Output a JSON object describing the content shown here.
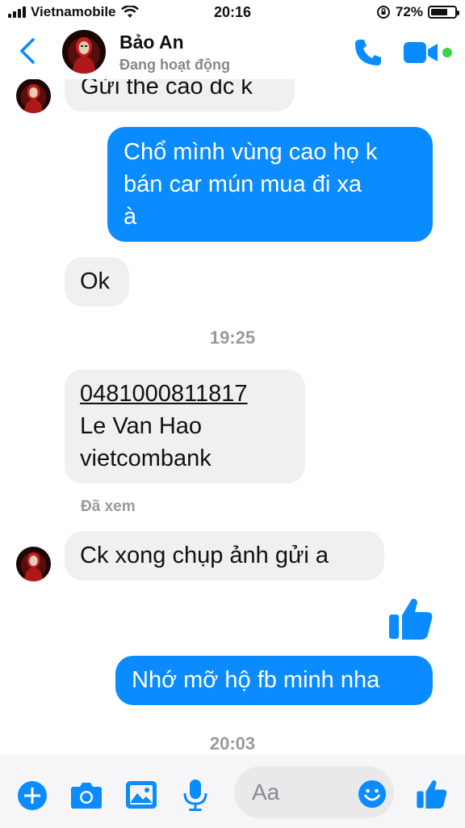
{
  "status_bar": {
    "carrier": "Vietnamobile",
    "time": "20:16",
    "battery": "72%",
    "battery_level": 0.72
  },
  "header": {
    "name": "Bảo An",
    "status": "Đang hoạt động",
    "icons": [
      "back-chevron",
      "avatar",
      "phone-icon",
      "video-icon",
      "online-dot"
    ]
  },
  "messages": {
    "m1": "Gửi the cao dc k",
    "m2_line1": "Chổ mình vùng cao họ k",
    "m2_line2": "bán car mún mua đi xa",
    "m2_line3": "à",
    "m3": "Ok",
    "time1": "19:25",
    "m4_account": "0481000811817",
    "m4_name": "Le Van Hao",
    "m4_bank": "vietcombank",
    "seen": "Đã xem",
    "m5": "Ck xong chụp ảnh gửi a",
    "m6": "Nhớ mỡ hộ fb minh nha",
    "time2": "20:03"
  },
  "composer": {
    "placeholder": "Aa",
    "icons": [
      "plus-icon",
      "camera-icon",
      "gallery-icon",
      "mic-icon",
      "emoji-icon",
      "like-icon"
    ]
  },
  "colors": {
    "accent": "#0a8bff",
    "incoming_bubble": "#f0f0f0",
    "timestamp": "#9a9a9a",
    "online": "#3ccf4e"
  }
}
